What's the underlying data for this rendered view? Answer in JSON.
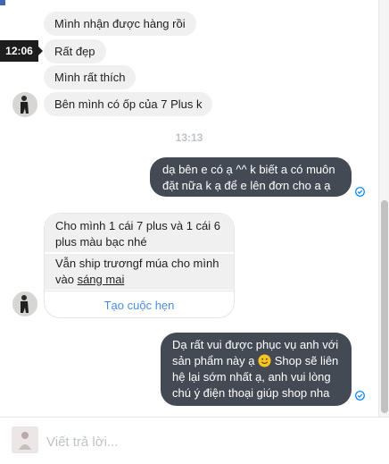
{
  "tooltip": {
    "time": "12:06"
  },
  "incoming_1": [
    "Mình nhận được hàng rồi",
    "Rất đẹp",
    "Mình rất thích",
    "Bên mình có ốp của 7 Plus k"
  ],
  "divider": {
    "time": "13:13"
  },
  "outgoing_1": {
    "line1": "dạ bên e có ạ ^^ k biết a có muôn",
    "line2": "đặt nữa k ạ để e lên đơn cho a ạ"
  },
  "card": {
    "line1": "Cho mình 1 cái 7 plus và 1 cái 6",
    "line2": "plus màu bạc nhé",
    "line3": "Vẫn ship trương",
    "line3b": "f múa cho mình",
    "line4": "vào ",
    "line4_link": "sáng mai",
    "button": "Tạo cuộc hẹn"
  },
  "outgoing_2": {
    "line1": "Dạ rất vui được phục vụ anh với",
    "line2a": "sản phẩm này ạ ",
    "line2b": " Shop sẽ liên",
    "line3": "hệ lại  sớm nhất ạ, anh vui lòng",
    "line4": "chú ý điện thoại giúp shop nha"
  },
  "composer": {
    "placeholder": "Viết trả lời..."
  },
  "colors": {
    "outgoing_bubble": "#434a54",
    "incoming_bubble": "#f1f0f0",
    "link": "#4a90e2",
    "seen": "#0084ff"
  }
}
